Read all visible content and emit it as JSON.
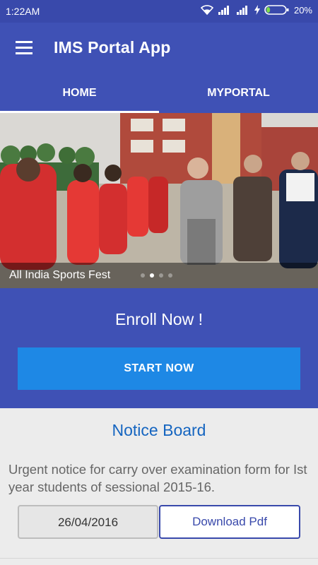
{
  "status_bar": {
    "time": "1:22AM",
    "battery_percent": "20%",
    "battery_level": 0.2,
    "icons": [
      "wifi-icon",
      "signal-icon",
      "signal-icon",
      "charging-icon",
      "battery-icon"
    ]
  },
  "app_bar": {
    "title": "IMS Portal App",
    "menu_icon": "hamburger-menu-icon"
  },
  "tabs": [
    {
      "label": "HOME",
      "active": true
    },
    {
      "label": "MYPORTAL",
      "active": false
    }
  ],
  "banner": {
    "caption": "All India Sports Fest",
    "slide_count": 4,
    "active_slide": 1
  },
  "enroll": {
    "title": "Enroll Now !",
    "button_label": "START NOW"
  },
  "notice_board": {
    "title": "Notice Board",
    "text": "Urgent notice for carry over examination form for Ist year students of sessional 2015-16.",
    "date": "26/04/2016",
    "download_label": "Download Pdf"
  },
  "colors": {
    "primary": "#3f51b5",
    "primary_dark": "#3949ab",
    "button_blue": "#1e88e5",
    "notice_title": "#1565c0"
  }
}
